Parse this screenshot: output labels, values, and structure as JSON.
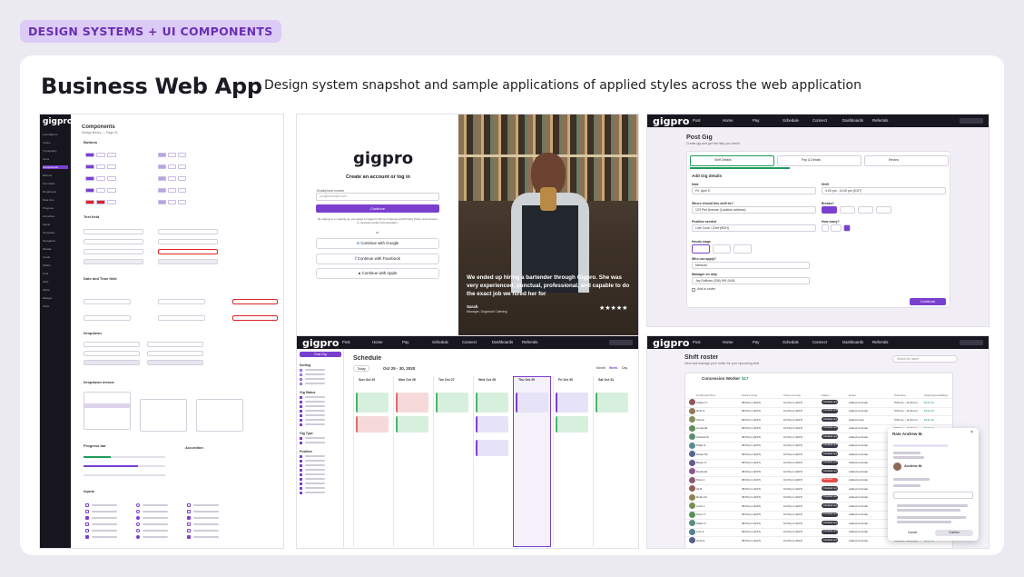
{
  "tag": "DESIGN SYSTEMS + UI COMPONENTS",
  "title": "Business Web App",
  "subtitle": "Design system snapshot and sample applications of applied styles across the web application",
  "panel1": {
    "logo": "gigpro",
    "heading": "Components",
    "sub": "Design library — Page 01",
    "sections": [
      "Buttons",
      "Text field",
      "Date and Time field",
      "Dropdown",
      "Dropdown menus",
      "Progress bar",
      "Accordion",
      "Inputs"
    ],
    "side_items": [
      "Foundations",
      "Colors",
      "Typography",
      "Icons",
      "Components",
      "Buttons",
      "Text fields",
      "Dropdowns",
      "Date time",
      "Progress",
      "Accordion",
      "Inputs",
      "Templates",
      "Navigation",
      "Modals",
      "Cards",
      "Tables",
      "Lists",
      "Tabs",
      "Alerts",
      "Badges",
      "Other"
    ]
  },
  "panel2": {
    "logo": "gigpro",
    "heading": "Create an account or log in",
    "field_label": "Email/phone number",
    "placeholder": "you@example.com",
    "continue": "Continue",
    "legal": "By signing in or signing up, you agree to Gigpro's Terms of Service and Privacy Policy, and consent to receiving email communication.",
    "or": "or",
    "google": "Continue with Google",
    "facebook": "Continue with Facebook",
    "apple": "Continue with Apple",
    "quote": "We ended up hiring a bartender through Gigpro. She was very experienced, punctual, professional, and capable to do the exact job we hired her for",
    "author": "Sarah",
    "author_role": "Manager, Dogwood Catering",
    "stars": "★★★★★"
  },
  "nav": [
    "Post",
    "Home",
    "Pay",
    "Schedule",
    "Connect",
    "Dashboards",
    "Referrals"
  ],
  "panel3": {
    "logo": "gigpro",
    "heading": "Post Gig",
    "sub": "Create gig and get the help you need!",
    "tabs": [
      "Shift Details",
      "Pay & Details",
      "Review"
    ],
    "section": "Add Gig details",
    "fields": [
      "Date",
      "Shift",
      "Where should this shift be?",
      "Breaks?",
      "Position needed",
      "How many?",
      "Hourly wage",
      "Who can apply?",
      "Manager on duty"
    ],
    "values": [
      "Fri, April 5",
      "4:00 pm - 11:00 pm (EDT)",
      "123 Pier Avenue (Location address)",
      "Line Cook / Chef (BOH)",
      "Network",
      "Jay Sullivan (336) 992-0404"
    ],
    "repost": "Add to roster",
    "button": "Continue"
  },
  "panel4": {
    "logo": "gigpro",
    "heading": "Schedule",
    "range": "Oct 25 - 30, 2020",
    "today": "Today",
    "view_tabs": [
      "Month",
      "Week",
      "Day"
    ],
    "days": [
      "Sun Oct 25",
      "Mon Oct 26",
      "Tue Oct 27",
      "Wed Oct 28",
      "Thu Oct 29",
      "Fri Oct 30",
      "Sat Oct 31"
    ],
    "filters": [
      "Sorting",
      "Gig Status",
      "Gig Type",
      "Position"
    ],
    "post": "Post Gig"
  },
  "panel5": {
    "logo": "gigpro",
    "heading": "Shift roster",
    "sub": "View and manage your roster for your upcoming shift",
    "search": "Search by name",
    "event": "Concession Worker",
    "wage": "$17",
    "columns": [
      "Confirmed Pros",
      "Clock in time",
      "Clock out time",
      "Status",
      "Notes",
      "Total time",
      "Total Payout",
      "Rating"
    ],
    "rows": [
      [
        "Chanel Y.",
        "08:00 pm (EST)",
        "10:00 pm (EST)",
        "Checked out",
        "Added reminder",
        "5:00 pm - 11:00 pm",
        "$133.30"
      ],
      [
        "Roth H.",
        "08:00 pm (EST)",
        "10:00 pm (EST)",
        "Checked out",
        "Added reminder",
        "5:00 pm - 11:00 pm",
        "$133.30"
      ],
      [
        "Tara E.",
        "08:00 pm (EST)",
        "10:00 pm (EST)",
        "Checked out",
        "Added notes",
        "5:00 pm - 11:00 pm",
        "$131.00"
      ],
      [
        "Armanda",
        "08:00 pm (EST)",
        "10:00 pm (EST)",
        "Checked out",
        "Added reminder",
        "5:00 pm - 11:00 pm",
        "$133.30"
      ],
      [
        "Orlando B.",
        "08:00 pm (EST)",
        "10:00 pm (EST)",
        "Checked out",
        "Added reminder",
        "5:00 pm - 11:00 pm",
        "$133.30"
      ],
      [
        "Philip S.",
        "08:00 pm (EST)",
        "10:00 pm (EST)",
        "Checked out",
        "Added reminder",
        "5:00 pm - 11:00 pm",
        "$133.30"
      ],
      [
        "Daniel W.",
        "08:00 pm (EST)",
        "10:00 pm (EST)",
        "Checked out",
        "Added reminder",
        "5:00 pm - 11:00 pm",
        "$133.30"
      ],
      [
        "Bryan N.",
        "08:00 pm (EST)",
        "10:00 pm (EST)",
        "Checked out",
        "Added reminder",
        "5:00 pm - 11:00 pm",
        "$133.30"
      ],
      [
        "Redondo",
        "08:00 pm (EST)",
        "10:00 pm (EST)",
        "Checked out",
        "Added reminder",
        "5:00 pm - 11:00 pm",
        "$133.30"
      ],
      [
        "Myra J.",
        "08:00 pm (EST)",
        "10:00 pm (EST)",
        "No show",
        "Added reminder",
        "5:00 pm - 11:00 pm",
        "$0.00"
      ],
      [
        "Ali B.",
        "08:00 pm (EST)",
        "10:00 pm (EST)",
        "Checked out",
        "Added reminder",
        "5:00 pm - 11:00 pm",
        "$133.30"
      ],
      [
        "Robin W.",
        "08:00 pm (EST)",
        "10:00 pm (EST)",
        "Checked out",
        "Added reminder",
        "5:00 pm - 11:00 pm",
        "$133.30"
      ],
      [
        "Leah J.",
        "08:00 pm (EST)",
        "10:00 pm (EST)",
        "Checked out",
        "Added reminder",
        "5:00 pm - 11:00 pm",
        "$133.30"
      ],
      [
        "Kevin T.",
        "08:00 pm (EST)",
        "10:00 pm (EST)",
        "Checked out",
        "Added reminder",
        "5:00 pm - 11:00 pm",
        "$133.30"
      ],
      [
        "Pablo S.",
        "08:00 pm (EST)",
        "10:00 pm (EST)",
        "Checked out",
        "Added reminder",
        "5:00 pm - 11:00 pm",
        "$133.30"
      ],
      [
        "Luis S.",
        "08:00 pm (EST)",
        "10:00 pm (EST)",
        "Checked out",
        "Added reminder",
        "5:00 pm - 11:00 pm",
        "$133.30"
      ],
      [
        "Gina S.",
        "08:00 pm (EST)",
        "10:00 pm (EST)",
        "Checked out",
        "Added reminder",
        "5:00 pm - 11:00 pm",
        "$133.30"
      ]
    ],
    "modal_title": "Rate Andrew M.",
    "modal_name": "Andrew M.",
    "cancel": "Cancel",
    "confirm": "Confirm"
  }
}
